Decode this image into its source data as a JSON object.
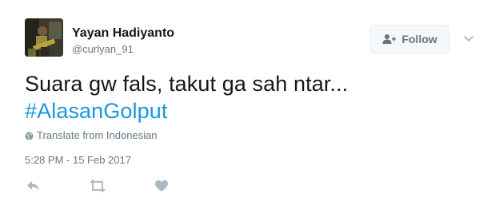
{
  "user": {
    "name": "Yayan Hadiyanto",
    "handle": "@curlyan_91"
  },
  "follow": {
    "label": "Follow"
  },
  "tweet": {
    "text": "Suara gw fals, takut ga sah ntar...",
    "hashtag": "#AlasanGolput"
  },
  "translate": {
    "label": "Translate from Indonesian"
  },
  "timestamp": "5:28 PM - 15 Feb 2017",
  "icons": {
    "follow": "add-user-icon",
    "menu": "chevron-down-icon",
    "translate": "globe-icon",
    "reply": "reply-icon",
    "retweet": "retweet-icon",
    "like": "heart-icon"
  },
  "colors": {
    "hashtag": "#1b95e0",
    "muted": "#657786",
    "action_icon": "#aab8c2"
  }
}
